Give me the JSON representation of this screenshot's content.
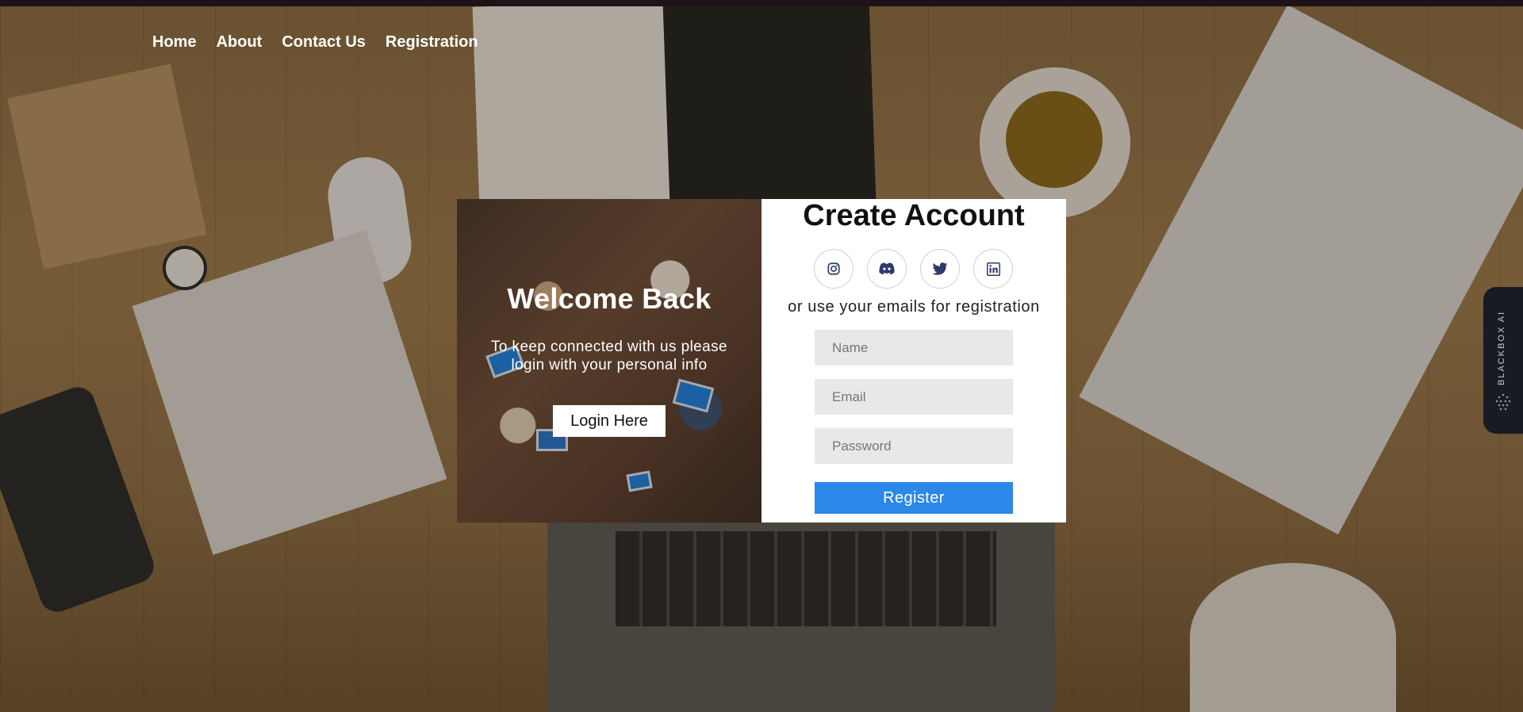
{
  "nav": {
    "items": [
      {
        "label": "Home"
      },
      {
        "label": "About"
      },
      {
        "label": "Contact Us"
      },
      {
        "label": "Registration"
      }
    ]
  },
  "left_panel": {
    "title": "Welcome Back",
    "subtitle": "To keep connected with us please login with your personal info",
    "login_button": "Login Here"
  },
  "right_panel": {
    "title": "Create Account",
    "socials": [
      "instagram-icon",
      "discord-icon",
      "twitter-icon",
      "linkedin-icon"
    ],
    "or_text": "or use your emails for registration",
    "name_placeholder": "Name",
    "email_placeholder": "Email",
    "password_placeholder": "Password",
    "register_button": "Register"
  },
  "side_tab": {
    "label": "BLACKBOX AI"
  },
  "colors": {
    "accent": "#2b88e8",
    "social_icon": "#2f3a68",
    "field_bg": "#e8e8e8"
  }
}
